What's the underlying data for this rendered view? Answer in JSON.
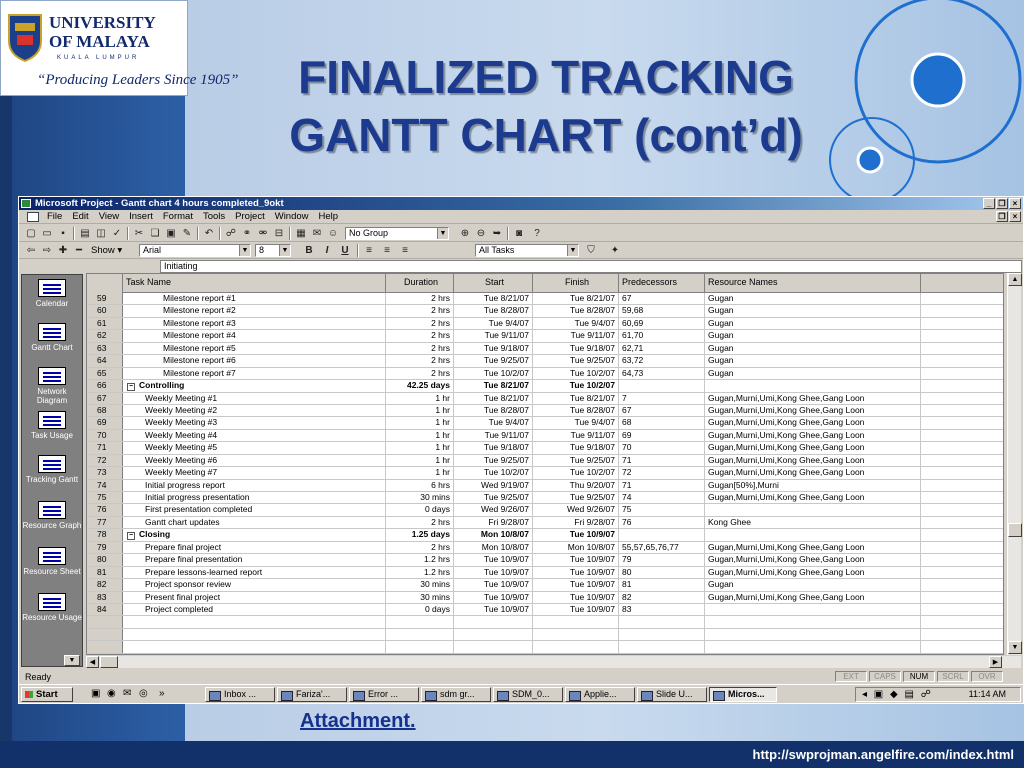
{
  "slide": {
    "title_line1": "FINALIZED TRACKING",
    "title_line2": "GANTT CHART (cont’d)",
    "logo_line1": "UNIVERSITY",
    "logo_line2": "OF MALAYA",
    "logo_city": "KUALA LUMPUR",
    "logo_motto": "“Producing Leaders Since 1905”",
    "attachment_link": "Attachment.",
    "footer_url": "http://swprojman.angelfire.com/index.html",
    "colors": {
      "title": "#1c3a8e",
      "footer": "#12306a",
      "accent_circle": "#1f6fcf"
    }
  },
  "window": {
    "title": "Microsoft Project - Gantt chart 4 hours completed_9okt",
    "menus": [
      "File",
      "Edit",
      "View",
      "Insert",
      "Format",
      "Tools",
      "Project",
      "Window",
      "Help"
    ],
    "toolbar": {
      "group_value": "No Group",
      "show_label": "Show",
      "font_value": "Arial",
      "size_value": "8",
      "filter_value": "All Tasks",
      "bold": "B",
      "italic": "I",
      "underline": "U"
    },
    "entry_value": "Initiating"
  },
  "viewbar": [
    {
      "label": "Calendar",
      "icon": "calendar-icon"
    },
    {
      "label": "Gantt Chart",
      "icon": "gantt-chart-icon"
    },
    {
      "label": "Network Diagram",
      "icon": "network-diagram-icon"
    },
    {
      "label": "Task Usage",
      "icon": "task-usage-icon"
    },
    {
      "label": "Tracking Gantt",
      "icon": "tracking-gantt-icon"
    },
    {
      "label": "Resource Graph",
      "icon": "resource-graph-icon"
    },
    {
      "label": "Resource Sheet",
      "icon": "resource-sheet-icon"
    },
    {
      "label": "Resource Usage",
      "icon": "resource-usage-icon"
    }
  ],
  "table": {
    "columns": [
      "Task Name",
      "Duration",
      "Start",
      "Finish",
      "Predecessors",
      "Resource Names"
    ],
    "rows": [
      {
        "id": "59",
        "name": "Milestone report #1",
        "level": 2,
        "duration": "2 hrs",
        "start": "Tue 8/21/07",
        "finish": "Tue 8/21/07",
        "pred": "67",
        "res": "Gugan"
      },
      {
        "id": "60",
        "name": "Milestone report #2",
        "level": 2,
        "duration": "2 hrs",
        "start": "Tue 8/28/07",
        "finish": "Tue 8/28/07",
        "pred": "59,68",
        "res": "Gugan"
      },
      {
        "id": "61",
        "name": "Milestone report #3",
        "level": 2,
        "duration": "2 hrs",
        "start": "Tue 9/4/07",
        "finish": "Tue 9/4/07",
        "pred": "60,69",
        "res": "Gugan"
      },
      {
        "id": "62",
        "name": "Milestone report #4",
        "level": 2,
        "duration": "2 hrs",
        "start": "Tue 9/11/07",
        "finish": "Tue 9/11/07",
        "pred": "61,70",
        "res": "Gugan"
      },
      {
        "id": "63",
        "name": "Milestone report #5",
        "level": 2,
        "duration": "2 hrs",
        "start": "Tue 9/18/07",
        "finish": "Tue 9/18/07",
        "pred": "62,71",
        "res": "Gugan"
      },
      {
        "id": "64",
        "name": "Milestone report #6",
        "level": 2,
        "duration": "2 hrs",
        "start": "Tue 9/25/07",
        "finish": "Tue 9/25/07",
        "pred": "63,72",
        "res": "Gugan"
      },
      {
        "id": "65",
        "name": "Milestone report #7",
        "level": 2,
        "duration": "2 hrs",
        "start": "Tue 10/2/07",
        "finish": "Tue 10/2/07",
        "pred": "64,73",
        "res": "Gugan"
      },
      {
        "id": "66",
        "name": "Controlling",
        "level": 0,
        "summary": true,
        "duration": "42.25 days",
        "start": "Tue 8/21/07",
        "finish": "Tue 10/2/07",
        "pred": "",
        "res": ""
      },
      {
        "id": "67",
        "name": "Weekly Meeting #1",
        "level": 1,
        "duration": "1 hr",
        "start": "Tue 8/21/07",
        "finish": "Tue 8/21/07",
        "pred": "7",
        "res": "Gugan,Murni,Umi,Kong Ghee,Gang Loon"
      },
      {
        "id": "68",
        "name": "Weekly Meeting #2",
        "level": 1,
        "duration": "1 hr",
        "start": "Tue 8/28/07",
        "finish": "Tue 8/28/07",
        "pred": "67",
        "res": "Gugan,Murni,Umi,Kong Ghee,Gang Loon"
      },
      {
        "id": "69",
        "name": "Weekly Meeting #3",
        "level": 1,
        "duration": "1 hr",
        "start": "Tue 9/4/07",
        "finish": "Tue 9/4/07",
        "pred": "68",
        "res": "Gugan,Murni,Umi,Kong Ghee,Gang Loon"
      },
      {
        "id": "70",
        "name": "Weekly Meeting #4",
        "level": 1,
        "duration": "1 hr",
        "start": "Tue 9/11/07",
        "finish": "Tue 9/11/07",
        "pred": "69",
        "res": "Gugan,Murni,Umi,Kong Ghee,Gang Loon"
      },
      {
        "id": "71",
        "name": "Weekly Meeting #5",
        "level": 1,
        "duration": "1 hr",
        "start": "Tue 9/18/07",
        "finish": "Tue 9/18/07",
        "pred": "70",
        "res": "Gugan,Murni,Umi,Kong Ghee,Gang Loon"
      },
      {
        "id": "72",
        "name": "Weekly Meeting #6",
        "level": 1,
        "duration": "1 hr",
        "start": "Tue 9/25/07",
        "finish": "Tue 9/25/07",
        "pred": "71",
        "res": "Gugan,Murni,Umi,Kong Ghee,Gang Loon"
      },
      {
        "id": "73",
        "name": "Weekly Meeting #7",
        "level": 1,
        "duration": "1 hr",
        "start": "Tue 10/2/07",
        "finish": "Tue 10/2/07",
        "pred": "72",
        "res": "Gugan,Murni,Umi,Kong Ghee,Gang Loon"
      },
      {
        "id": "74",
        "name": "Initial progress report",
        "level": 1,
        "duration": "6 hrs",
        "start": "Wed 9/19/07",
        "finish": "Thu 9/20/07",
        "pred": "71",
        "res": "Gugan[50%],Murni"
      },
      {
        "id": "75",
        "name": "Initial progress presentation",
        "level": 1,
        "duration": "30 mins",
        "start": "Tue 9/25/07",
        "finish": "Tue 9/25/07",
        "pred": "74",
        "res": "Gugan,Murni,Umi,Kong Ghee,Gang Loon"
      },
      {
        "id": "76",
        "name": "First presentation completed",
        "level": 1,
        "duration": "0 days",
        "start": "Wed 9/26/07",
        "finish": "Wed 9/26/07",
        "pred": "75",
        "res": ""
      },
      {
        "id": "77",
        "name": "Gantt chart updates",
        "level": 1,
        "duration": "2 hrs",
        "start": "Fri 9/28/07",
        "finish": "Fri 9/28/07",
        "pred": "76",
        "res": "Kong Ghee"
      },
      {
        "id": "78",
        "name": "Closing",
        "level": 0,
        "summary": true,
        "duration": "1.25 days",
        "start": "Mon 10/8/07",
        "finish": "Tue 10/9/07",
        "pred": "",
        "res": ""
      },
      {
        "id": "79",
        "name": "Prepare final project",
        "level": 1,
        "duration": "2 hrs",
        "start": "Mon 10/8/07",
        "finish": "Mon 10/8/07",
        "pred": "55,57,65,76,77",
        "res": "Gugan,Murni,Umi,Kong Ghee,Gang Loon"
      },
      {
        "id": "80",
        "name": "Prepare final presentation",
        "level": 1,
        "duration": "1.2 hrs",
        "start": "Tue 10/9/07",
        "finish": "Tue 10/9/07",
        "pred": "79",
        "res": "Gugan,Murni,Umi,Kong Ghee,Gang Loon"
      },
      {
        "id": "81",
        "name": "Prepare lessons-learned report",
        "level": 1,
        "duration": "1.2 hrs",
        "start": "Tue 10/9/07",
        "finish": "Tue 10/9/07",
        "pred": "80",
        "res": "Gugan,Murni,Umi,Kong Ghee,Gang Loon"
      },
      {
        "id": "82",
        "name": "Project sponsor review",
        "level": 1,
        "duration": "30 mins",
        "start": "Tue 10/9/07",
        "finish": "Tue 10/9/07",
        "pred": "81",
        "res": "Gugan"
      },
      {
        "id": "83",
        "name": "Present final project",
        "level": 1,
        "duration": "30 mins",
        "start": "Tue 10/9/07",
        "finish": "Tue 10/9/07",
        "pred": "82",
        "res": "Gugan,Murni,Umi,Kong Ghee,Gang Loon"
      },
      {
        "id": "84",
        "name": "Project completed",
        "level": 1,
        "duration": "0 days",
        "start": "Tue 10/9/07",
        "finish": "Tue 10/9/07",
        "pred": "83",
        "res": ""
      }
    ],
    "empty_rows": 4
  },
  "status": {
    "text": "Ready",
    "indicators": [
      {
        "label": "EXT",
        "on": false
      },
      {
        "label": "CAPS",
        "on": false
      },
      {
        "label": "NUM",
        "on": true
      },
      {
        "label": "SCRL",
        "on": false
      },
      {
        "label": "OVR",
        "on": false
      }
    ]
  },
  "taskbar": {
    "start": "Start",
    "buttons": [
      {
        "label": "Inbox ...",
        "active": false
      },
      {
        "label": "Fariza'...",
        "active": false
      },
      {
        "label": "Error ...",
        "active": false
      },
      {
        "label": "sdm gr...",
        "active": false
      },
      {
        "label": "SDM_0...",
        "active": false
      },
      {
        "label": "Applie...",
        "active": false
      },
      {
        "label": "Slide U...",
        "active": false
      },
      {
        "label": "Micros...",
        "active": true
      }
    ],
    "clock": "11:14 AM"
  }
}
